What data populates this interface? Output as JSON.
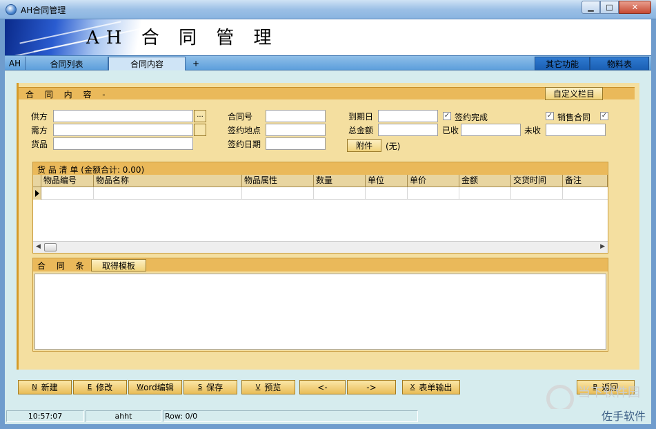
{
  "window": {
    "title": "AH合同管理",
    "minimize": "▁",
    "maximize": "□",
    "close": "✕"
  },
  "banner": {
    "title": "AH 合 同 管 理"
  },
  "tabs": {
    "ah": "AH",
    "contract_list": "合同列表",
    "contract_content": "合同内容",
    "add": "+",
    "other_functions": "其它功能",
    "materials": "物料表"
  },
  "panel": {
    "title": "合 同 内 容 -",
    "custom_columns": "自定义栏目",
    "supplier_label": "供方",
    "supplier_value": "",
    "demander_label": "需方",
    "demander_value": "",
    "goods_label": "货品",
    "goods_value": "",
    "browse": "...",
    "contract_no_label": "合同号",
    "contract_no_value": "",
    "sign_place_label": "签约地点",
    "sign_place_value": "",
    "sign_date_label": "签约日期",
    "sign_date_value": "",
    "due_date_label": "到期日",
    "due_date_value": "",
    "total_label": "总金额",
    "total_value": "",
    "attachment": "附件",
    "attachment_status": "(无)",
    "sign_done_label": "签约完成",
    "sign_done_checked": "✓",
    "received_label": "已收",
    "received_value": "",
    "sales_contract_label": "销售合同",
    "sales_contract_checked": "✓",
    "extra_checked": "✓",
    "unreceived_label": "未收",
    "unreceived_value": ""
  },
  "goods_list": {
    "caption": "货 品 清 单 (金额合计: 0.00)",
    "columns": [
      "物品编号",
      "物品名称",
      "物品属性",
      "数量",
      "单位",
      "单价",
      "金额",
      "交货时间",
      "备注"
    ],
    "scroll_left": "◀",
    "scroll_right": "▶"
  },
  "terms": {
    "title": "合 同 条 款",
    "get_template": "取得模板"
  },
  "toolbar": {
    "new_key": "N",
    "new": "新建",
    "edit_key": "E",
    "edit": "修改",
    "word_key": "W",
    "word": "ord编辑",
    "save_key": "S",
    "save": "保存",
    "preview_key": "V",
    "preview": "预览",
    "prev": "<-",
    "next": "->",
    "export_key": "X",
    "export": "表单输出",
    "back_key": "B",
    "back": "返回"
  },
  "status": {
    "time": "10:57:07",
    "user": "ahht",
    "row": "Row: 0/0"
  },
  "watermark": {
    "line1": "当下软件园",
    "line2": "佐手软件",
    "line3": "www.downxia.com"
  }
}
